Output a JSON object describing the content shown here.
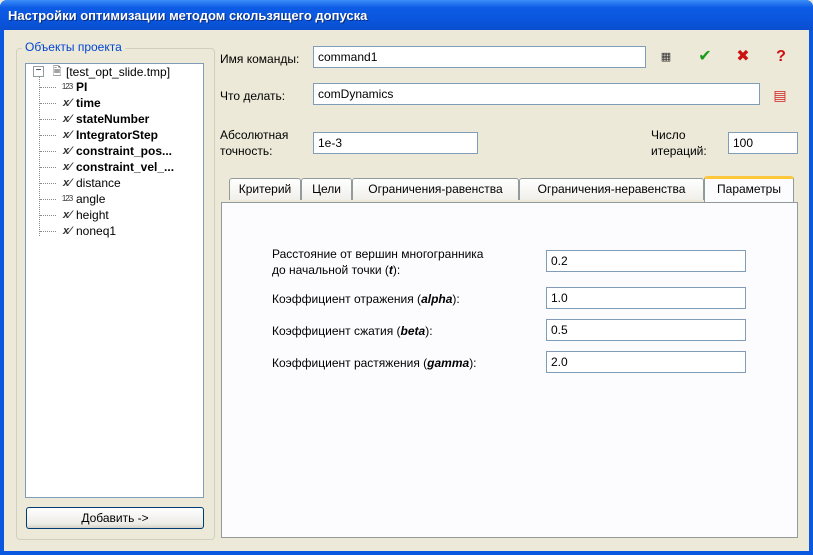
{
  "window": {
    "title": "Настройки оптимизации методом скользящего допуска"
  },
  "objects_panel": {
    "legend": "Объекты проекта",
    "root": {
      "label": "[test_opt_slide.tmp]"
    },
    "items": [
      {
        "label": "PI",
        "icon": "number-icon",
        "bold": true
      },
      {
        "label": "time",
        "icon": "variable-icon",
        "bold": true
      },
      {
        "label": "stateNumber",
        "icon": "variable-icon",
        "bold": true
      },
      {
        "label": "IntegratorStep",
        "icon": "variable-icon",
        "bold": true
      },
      {
        "label": "constraint_pos...",
        "icon": "variable-icon",
        "bold": true
      },
      {
        "label": "constraint_vel_...",
        "icon": "variable-icon",
        "bold": true
      },
      {
        "label": "distance",
        "icon": "variable-icon",
        "bold": false
      },
      {
        "label": "angle",
        "icon": "number-icon",
        "bold": false
      },
      {
        "label": "height",
        "icon": "variable-icon",
        "bold": false
      },
      {
        "label": "noneq1",
        "icon": "variable-icon",
        "bold": false
      }
    ],
    "add_button": "Добавить ->"
  },
  "form": {
    "command_name_label": "Имя команды:",
    "command_name_value": "command1",
    "what_to_do_label": "Что делать:",
    "what_to_do_value": "comDynamics",
    "abs_precision_label_1": "Абсолютная",
    "abs_precision_label_2": "точность:",
    "abs_precision_value": "1e-3",
    "iterations_label_1": "Число",
    "iterations_label_2": "итераций:",
    "iterations_value": "100"
  },
  "tabs": [
    "Критерий",
    "Цели",
    "Ограничения-равенства",
    "Ограничения-неравенства",
    "Параметры"
  ],
  "active_tab": "Параметры",
  "params": [
    {
      "label_1": "Расстояние от вершин многогранника",
      "label_2": "до начальной точки (",
      "symbol": "t",
      "suffix": "):",
      "value": "0.2"
    },
    {
      "label_1": "Коэффициент отражения (",
      "symbol": "alpha",
      "suffix": "):",
      "value": "1.0"
    },
    {
      "label_1": "Коэффициент сжатия (",
      "symbol": "beta",
      "suffix": "):",
      "value": "0.5"
    },
    {
      "label_1": "Коэффициент растяжения (",
      "symbol": "gamma",
      "suffix": "):",
      "value": "2.0"
    }
  ]
}
